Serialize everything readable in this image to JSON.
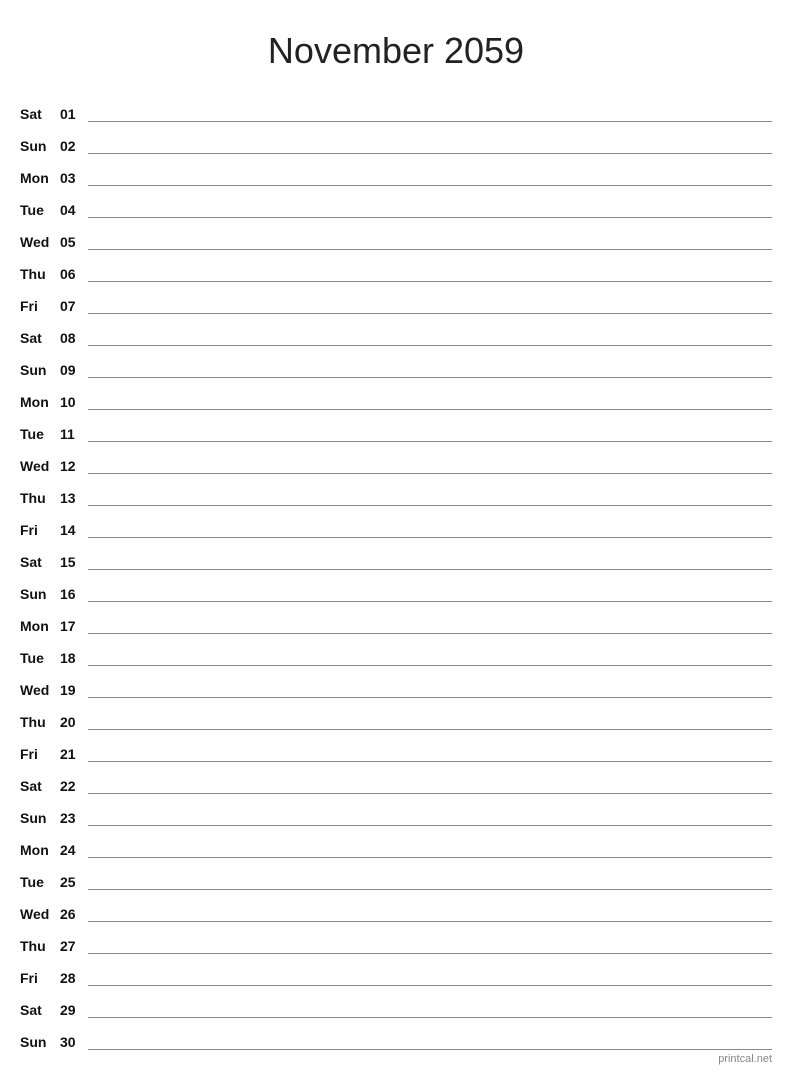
{
  "title": "November 2059",
  "footer": "printcal.net",
  "days": [
    {
      "name": "Sat",
      "num": "01"
    },
    {
      "name": "Sun",
      "num": "02"
    },
    {
      "name": "Mon",
      "num": "03"
    },
    {
      "name": "Tue",
      "num": "04"
    },
    {
      "name": "Wed",
      "num": "05"
    },
    {
      "name": "Thu",
      "num": "06"
    },
    {
      "name": "Fri",
      "num": "07"
    },
    {
      "name": "Sat",
      "num": "08"
    },
    {
      "name": "Sun",
      "num": "09"
    },
    {
      "name": "Mon",
      "num": "10"
    },
    {
      "name": "Tue",
      "num": "11"
    },
    {
      "name": "Wed",
      "num": "12"
    },
    {
      "name": "Thu",
      "num": "13"
    },
    {
      "name": "Fri",
      "num": "14"
    },
    {
      "name": "Sat",
      "num": "15"
    },
    {
      "name": "Sun",
      "num": "16"
    },
    {
      "name": "Mon",
      "num": "17"
    },
    {
      "name": "Tue",
      "num": "18"
    },
    {
      "name": "Wed",
      "num": "19"
    },
    {
      "name": "Thu",
      "num": "20"
    },
    {
      "name": "Fri",
      "num": "21"
    },
    {
      "name": "Sat",
      "num": "22"
    },
    {
      "name": "Sun",
      "num": "23"
    },
    {
      "name": "Mon",
      "num": "24"
    },
    {
      "name": "Tue",
      "num": "25"
    },
    {
      "name": "Wed",
      "num": "26"
    },
    {
      "name": "Thu",
      "num": "27"
    },
    {
      "name": "Fri",
      "num": "28"
    },
    {
      "name": "Sat",
      "num": "29"
    },
    {
      "name": "Sun",
      "num": "30"
    }
  ]
}
